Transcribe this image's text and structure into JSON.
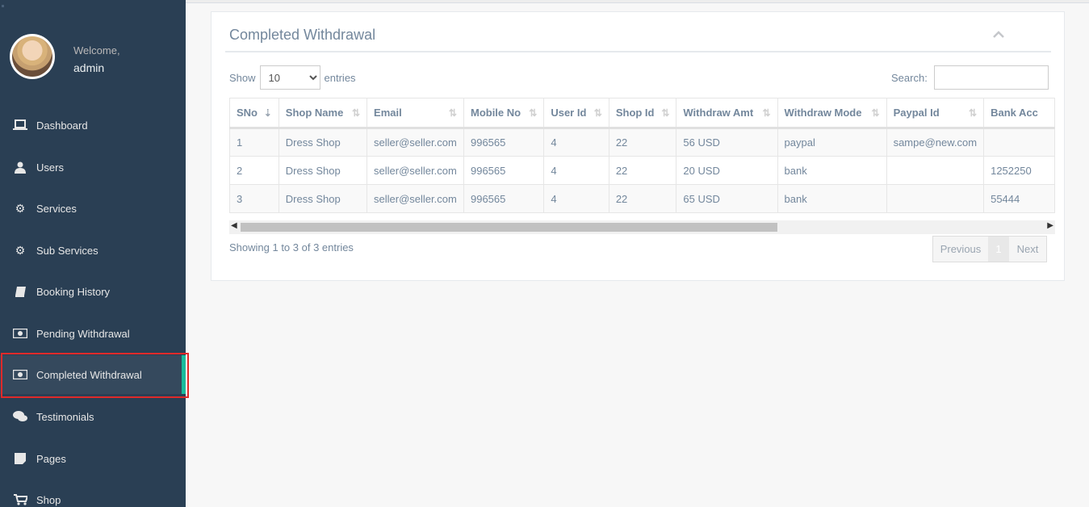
{
  "sidebar": {
    "welcome": "Welcome,",
    "username": "admin",
    "items": [
      {
        "label": "Dashboard",
        "icon": "laptop-icon"
      },
      {
        "label": "Users",
        "icon": "user-icon"
      },
      {
        "label": "Services",
        "icon": "gear-icon"
      },
      {
        "label": "Sub Services",
        "icon": "gear-icon"
      },
      {
        "label": "Booking History",
        "icon": "book-icon"
      },
      {
        "label": "Pending Withdrawal",
        "icon": "money-icon"
      },
      {
        "label": "Completed Withdrawal",
        "icon": "money-icon",
        "active": true
      },
      {
        "label": "Testimonials",
        "icon": "comments-icon"
      },
      {
        "label": "Pages",
        "icon": "file-icon"
      },
      {
        "label": "Shop",
        "icon": "cart-icon"
      }
    ]
  },
  "panel": {
    "title": "Completed Withdrawal",
    "show_label": "Show",
    "entries_label": "entries",
    "page_length": "10",
    "search_label": "Search:",
    "search_value": "",
    "columns": [
      "SNo",
      "Shop Name",
      "Email",
      "Mobile No",
      "User Id",
      "Shop Id",
      "Withdraw Amt",
      "Withdraw Mode",
      "Paypal Id",
      "Bank Acc"
    ],
    "rows": [
      [
        "1",
        "Dress Shop",
        "seller@seller.com",
        "996565",
        "4",
        "22",
        "56 USD",
        "paypal",
        "sampe@new.com",
        ""
      ],
      [
        "2",
        "Dress Shop",
        "seller@seller.com",
        "996565",
        "4",
        "22",
        "20 USD",
        "bank",
        "",
        "1252250"
      ],
      [
        "3",
        "Dress Shop",
        "seller@seller.com",
        "996565",
        "4",
        "22",
        "65 USD",
        "bank",
        "",
        "55444"
      ]
    ],
    "info": "Showing 1 to 3 of 3 entries",
    "pagination": {
      "previous": "Previous",
      "current": "1",
      "next": "Next"
    }
  },
  "colors": {
    "sidebar_bg": "#2a3f54",
    "accent": "#1abb9c",
    "text": "#73879c"
  }
}
